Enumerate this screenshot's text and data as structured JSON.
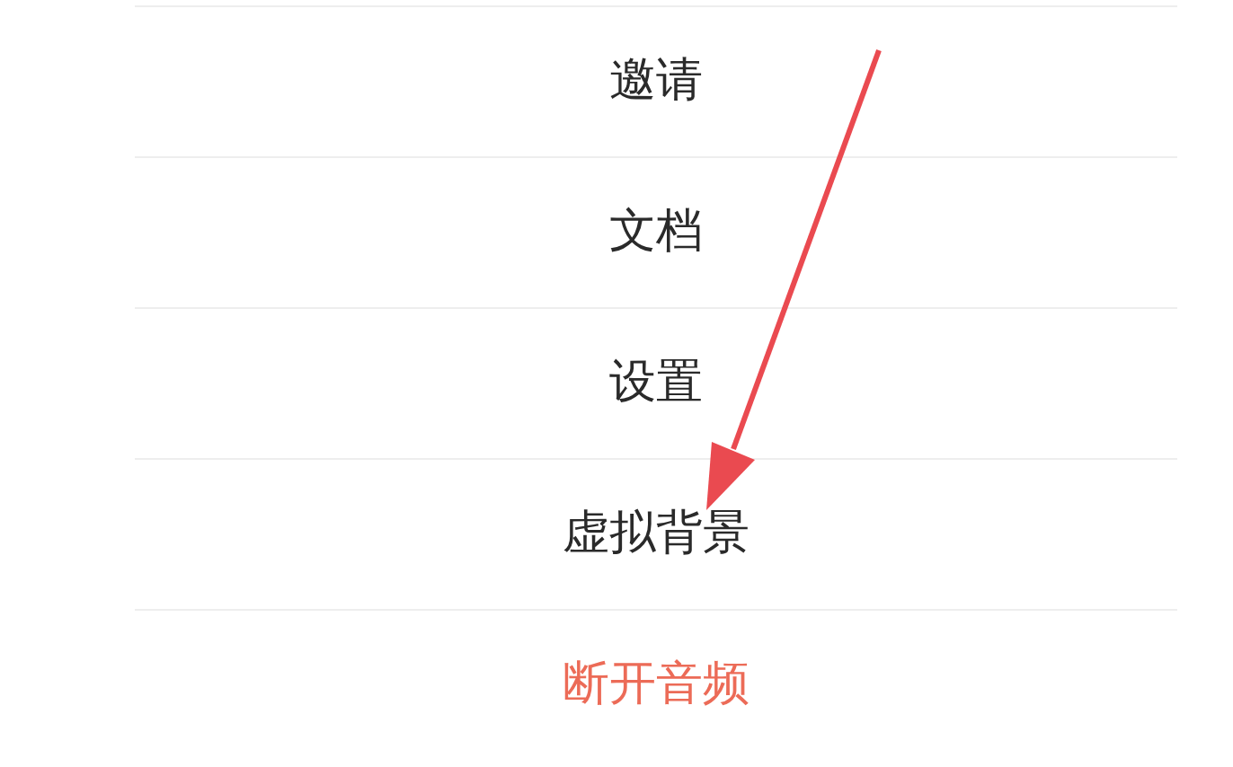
{
  "menu": {
    "items": [
      {
        "label": "邀请",
        "kind": "normal"
      },
      {
        "label": "文档",
        "kind": "normal"
      },
      {
        "label": "设置",
        "kind": "normal"
      },
      {
        "label": "虚拟背景",
        "kind": "normal"
      },
      {
        "label": "断开音频",
        "kind": "danger"
      }
    ]
  }
}
